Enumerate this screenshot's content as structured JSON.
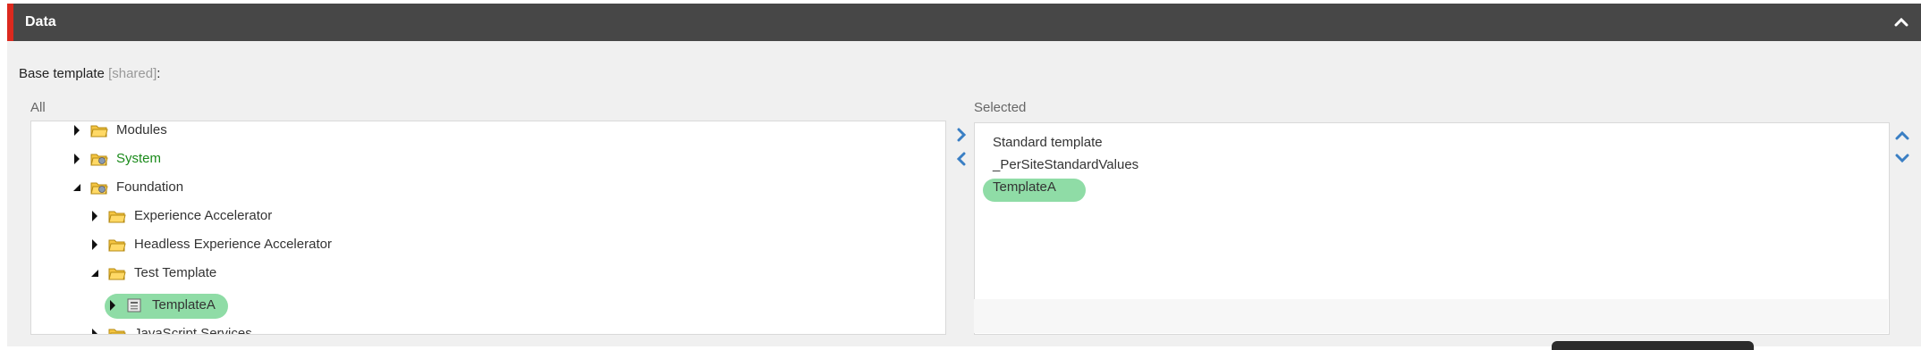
{
  "section": {
    "title": "Data",
    "collapse_icon": "chevron-up-icon"
  },
  "field": {
    "label": "Base template",
    "shared_tag": "[shared]",
    "colon": ":"
  },
  "all_list": {
    "caption": "All",
    "items": [
      {
        "label": "Modules",
        "color": "default",
        "expanded": false
      },
      {
        "label": "System",
        "color": "#1a8a1a",
        "expanded": false
      },
      {
        "label": "Foundation",
        "color": "default",
        "expanded": true
      },
      {
        "label": "Experience Accelerator",
        "color": "default",
        "expanded": false
      },
      {
        "label": "Headless Experience Accelerator",
        "color": "default",
        "expanded": false
      },
      {
        "label": "Test Template",
        "color": "default",
        "expanded": true
      },
      {
        "label": "TemplateA",
        "color": "default",
        "selected": true
      },
      {
        "label": "JavaScript Services",
        "color": "default",
        "partially_visible": true
      }
    ]
  },
  "selected_list": {
    "caption": "Selected",
    "items": [
      {
        "label": "Standard template"
      },
      {
        "label": "_PerSiteStandardValues"
      },
      {
        "label": "TemplateA",
        "highlighted": true
      }
    ]
  },
  "controls": {
    "add_icon": "chevron-right-icon",
    "remove_icon": "chevron-left-icon",
    "move_up_icon": "chevron-up-icon",
    "move_down_icon": "chevron-down-icon"
  },
  "colors": {
    "header_bg": "#474747",
    "accent": "#dc291e",
    "highlight": "#8fdca6",
    "arrow_blue": "#3a7fc4"
  }
}
